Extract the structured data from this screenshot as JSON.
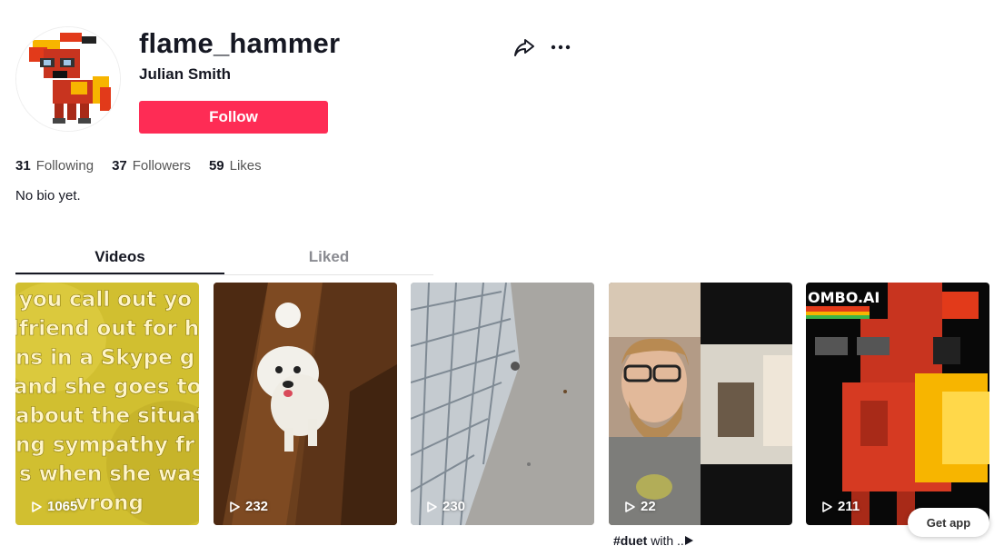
{
  "profile": {
    "username": "flame_hammer",
    "display_name": "Julian Smith",
    "follow_label": "Follow",
    "bio": "No bio yet."
  },
  "stats": [
    {
      "count": "31",
      "label": "Following"
    },
    {
      "count": "37",
      "label": "Followers"
    },
    {
      "count": "59",
      "label": "Likes"
    }
  ],
  "tabs": [
    {
      "label": "Videos",
      "active": true
    },
    {
      "label": "Liked",
      "active": false
    }
  ],
  "videos": [
    {
      "views": "1065",
      "thumb": "yellow-text-meme",
      "overlay_lines": [
        "you call out yo",
        "lfriend out for h",
        "ns in a Skype g",
        "and she goes to",
        "about the situat",
        "ng sympathy fr",
        "s when she was",
        "vrong"
      ]
    },
    {
      "views": "232",
      "thumb": "white-dog-on-wood-floor"
    },
    {
      "views": "230",
      "thumb": "shopping-cart-on-concrete"
    },
    {
      "views": "22",
      "thumb": "duet-bearded-man"
    },
    {
      "views": "211",
      "thumb": "pixel-pony-art",
      "overlay_text": "OMBO.AI"
    }
  ],
  "video_caption": {
    "tag": "#duet",
    "rest": "with .."
  },
  "get_app_label": "Get app",
  "icons": {
    "share": "share-arrow-icon",
    "more": "more-dots-icon",
    "play": "play-icon"
  },
  "colors": {
    "accent": "#fe2c55",
    "text": "#161823",
    "muted": "#8a8b91"
  }
}
